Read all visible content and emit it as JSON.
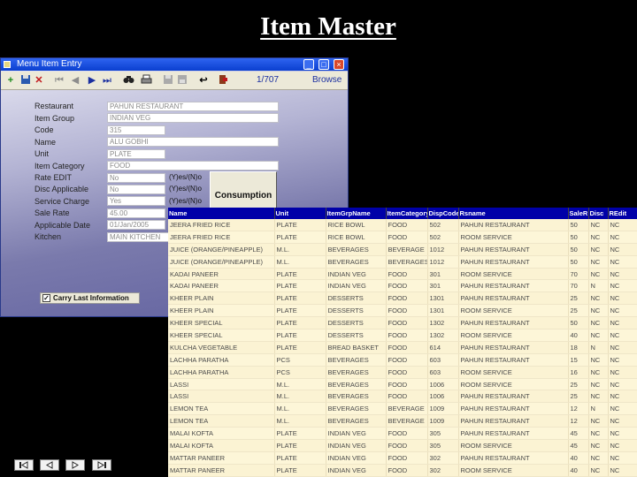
{
  "slide": {
    "title": "Item Master"
  },
  "window": {
    "title": "Menu Item Entry",
    "record_counter": "1/707",
    "mode": "Browse",
    "buttons": {
      "minimize": "_",
      "maximize": "□",
      "close": "×"
    }
  },
  "toolbar": {
    "icons": [
      "add-icon",
      "save-icon",
      "delete-icon",
      "first-record-icon",
      "previous-record-icon",
      "next-record-icon",
      "last-record-icon",
      "find-icon",
      "print-icon",
      "disk-icon",
      "disk2-icon",
      "undo-icon",
      "exit-icon"
    ]
  },
  "form": {
    "fields": [
      {
        "label": "Restaurant",
        "value": "PAHUN RESTAURANT"
      },
      {
        "label": "Item Group",
        "value": "INDIAN VEG"
      },
      {
        "label": "Code",
        "value": "315"
      },
      {
        "label": "Name",
        "value": "ALU GOBHI"
      },
      {
        "label": "Unit",
        "value": "PLATE"
      },
      {
        "label": "Item Category",
        "value": "FOOD"
      },
      {
        "label": "Rate EDIT",
        "value": "No",
        "hint": "(Y)es/(N)o"
      },
      {
        "label": "Disc Applicable",
        "value": "No",
        "hint": "(Y)es/(N)o"
      },
      {
        "label": "Service Charge",
        "value": "Yes",
        "hint": "(Y)es/(N)o"
      },
      {
        "label": "Sale Rate",
        "value": "45.00"
      },
      {
        "label": "Applicable Date",
        "value": "01/Jan/2005"
      },
      {
        "label": "Kitchen",
        "value": "MAIN KITCHEN"
      }
    ],
    "consumption_button": "Consumption",
    "carry_last_label": "Carry Last Information",
    "carry_last_checked": true
  },
  "grid": {
    "columns": [
      "Name",
      "Unit",
      "ItemGrpName",
      "ItemCategory",
      "DispCode",
      "Rsname",
      "SaleR",
      "Disc",
      "REdit"
    ],
    "rows": [
      [
        "JEERA FRIED RICE",
        "PLATE",
        "RICE BOWL",
        "FOOD",
        "502",
        "PAHUN RESTAURANT",
        "50",
        "NC",
        "NC"
      ],
      [
        "JEERA FRIED RICE",
        "PLATE",
        "RICE BOWL",
        "FOOD",
        "502",
        "ROOM SERVICE",
        "50",
        "NC",
        "NC"
      ],
      [
        "JUICE (ORANGE/PINEAPPLE)",
        "M.L.",
        "BEVERAGES",
        "BEVERAGE",
        "1012",
        "PAHUN RESTAURANT",
        "50",
        "NC",
        "NC"
      ],
      [
        "JUICE (ORANGE/PINEAPPLE)",
        "M.L.",
        "BEVERAGES",
        "BEVERAGES",
        "1012",
        "PAHUN RESTAURANT",
        "50",
        "NC",
        "NC"
      ],
      [
        "KADAI PANEER",
        "PLATE",
        "INDIAN VEG",
        "FOOD",
        "301",
        "ROOM SERVICE",
        "70",
        "NC",
        "NC"
      ],
      [
        "KADAI PANEER",
        "PLATE",
        "INDIAN VEG",
        "FOOD",
        "301",
        "PAHUN RESTAURANT",
        "70",
        "N",
        "NC"
      ],
      [
        "KHEER PLAIN",
        "PLATE",
        "DESSERTS",
        "FOOD",
        "1301",
        "PAHUN RESTAURANT",
        "25",
        "NC",
        "NC"
      ],
      [
        "KHEER PLAIN",
        "PLATE",
        "DESSERTS",
        "FOOD",
        "1301",
        "ROOM SERVICE",
        "25",
        "NC",
        "NC"
      ],
      [
        "KHEER SPECIAL",
        "PLATE",
        "DESSERTS",
        "FOOD",
        "1302",
        "PAHUN RESTAURANT",
        "50",
        "NC",
        "NC"
      ],
      [
        "KHEER SPECIAL",
        "PLATE",
        "DESSERTS",
        "FOOD",
        "1302",
        "ROOM SERVICE",
        "40",
        "NC",
        "NC"
      ],
      [
        "KULCHA VEGETABLE",
        "PLATE",
        "BREAD BASKET",
        "FOOD",
        "614",
        "PAHUN RESTAURANT",
        "18",
        "N",
        "NC"
      ],
      [
        "LACHHA PARATHA",
        "PCS",
        "BEVERAGES",
        "FOOD",
        "603",
        "PAHUN RESTAURANT",
        "15",
        "NC",
        "NC"
      ],
      [
        "LACHHA PARATHA",
        "PCS",
        "BEVERAGES",
        "FOOD",
        "603",
        "ROOM SERVICE",
        "16",
        "NC",
        "NC"
      ],
      [
        "LASSI",
        "M.L.",
        "BEVERAGES",
        "FOOD",
        "1006",
        "ROOM SERVICE",
        "25",
        "NC",
        "NC"
      ],
      [
        "LASSI",
        "M.L.",
        "BEVERAGES",
        "FOOD",
        "1006",
        "PAHUN RESTAURANT",
        "25",
        "NC",
        "NC"
      ],
      [
        "LEMON TEA",
        "M.L.",
        "BEVERAGES",
        "BEVERAGE",
        "1009",
        "PAHUN RESTAURANT",
        "12",
        "N",
        "NC"
      ],
      [
        "LEMON TEA",
        "M.L.",
        "BEVERAGES",
        "BEVERAGE",
        "1009",
        "PAHUN RESTAURANT",
        "12",
        "NC",
        "NC"
      ],
      [
        "MALAI KOFTA",
        "PLATE",
        "INDIAN VEG",
        "FOOD",
        "305",
        "PAHUN RESTAURANT",
        "45",
        "NC",
        "NC"
      ],
      [
        "MALAI KOFTA",
        "PLATE",
        "INDIAN VEG",
        "FOOD",
        "305",
        "ROOM SERVICE",
        "45",
        "NC",
        "NC"
      ],
      [
        "MATTAR PANEER",
        "PLATE",
        "INDIAN VEG",
        "FOOD",
        "302",
        "PAHUN RESTAURANT",
        "40",
        "NC",
        "NC"
      ],
      [
        "MATTAR PANEER",
        "PLATE",
        "INDIAN VEG",
        "FOOD",
        "302",
        "ROOM SERVICE",
        "40",
        "NC",
        "NC"
      ]
    ]
  },
  "slide_nav": {
    "icons": [
      "first-slide-icon",
      "previous-slide-icon",
      "next-slide-icon",
      "last-slide-icon"
    ]
  }
}
